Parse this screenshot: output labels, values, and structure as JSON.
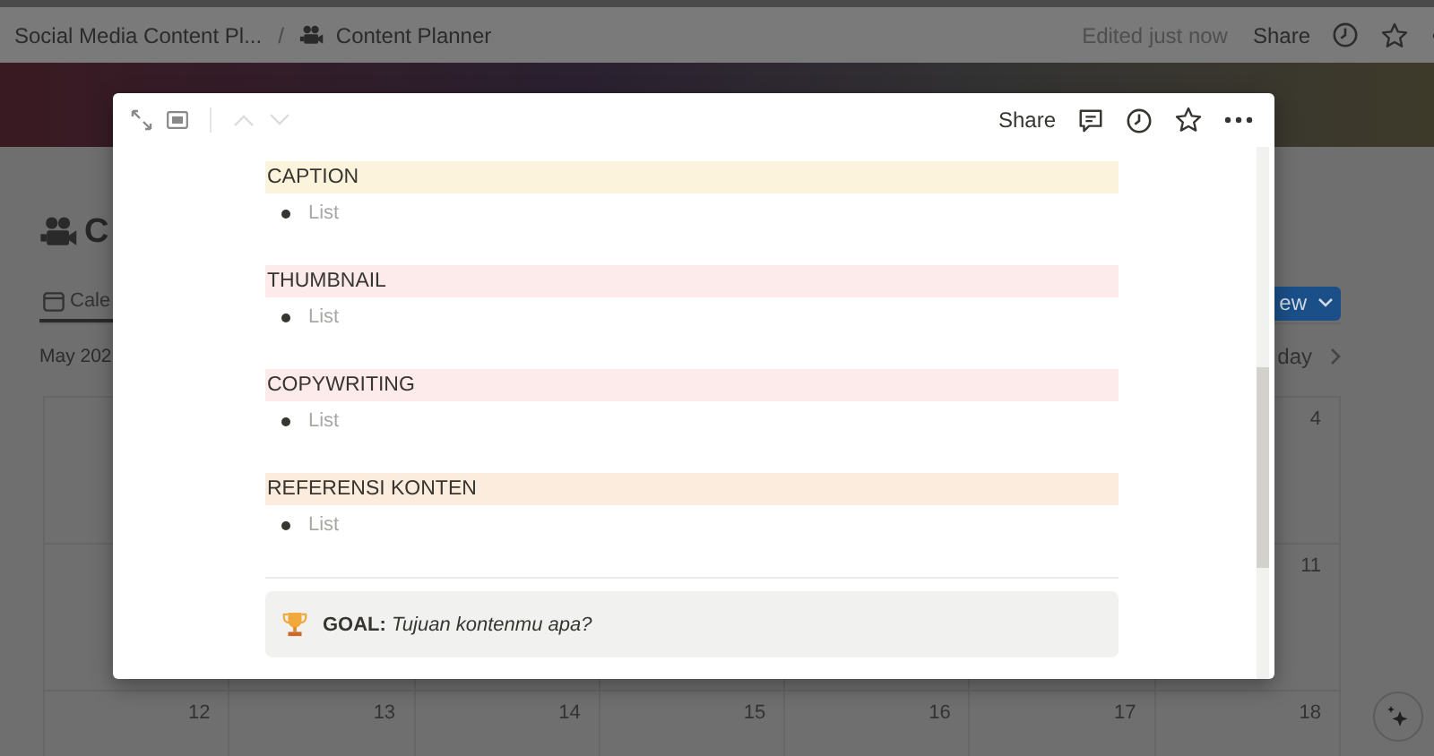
{
  "topbar": {
    "breadcrumbs": [
      {
        "label": "Social Media Content Pl..."
      },
      {
        "label": "Content Planner"
      }
    ],
    "separator": "/",
    "edited": "Edited just now",
    "share": "Share"
  },
  "page": {
    "title": "C",
    "tabs": [
      {
        "label": "Cale",
        "selected": true
      }
    ],
    "new_button": "ew",
    "month": "May 202",
    "today_button": "day",
    "weeks": [
      [
        "4"
      ],
      [
        "11"
      ],
      [
        "12",
        "13",
        "14",
        "15",
        "16",
        "17",
        "18"
      ]
    ]
  },
  "modal": {
    "share": "Share",
    "navigation": {
      "previous_disabled": true,
      "next_disabled": true
    },
    "sections": [
      {
        "heading": "CAPTION",
        "color": "#fbf3db",
        "items": [
          {
            "placeholder": "List"
          }
        ]
      },
      {
        "heading": "THUMBNAIL",
        "color": "#fdebec",
        "items": [
          {
            "placeholder": "List"
          }
        ]
      },
      {
        "heading": "COPYWRITING",
        "color": "#fdebec",
        "items": [
          {
            "placeholder": "List"
          }
        ]
      },
      {
        "heading": "REFERENSI KONTEN",
        "color": "#fbecdd",
        "items": [
          {
            "placeholder": "List"
          }
        ]
      }
    ],
    "callout": {
      "text": "**GOAL:** *Tujuan kontenmu apa?*"
    }
  }
}
